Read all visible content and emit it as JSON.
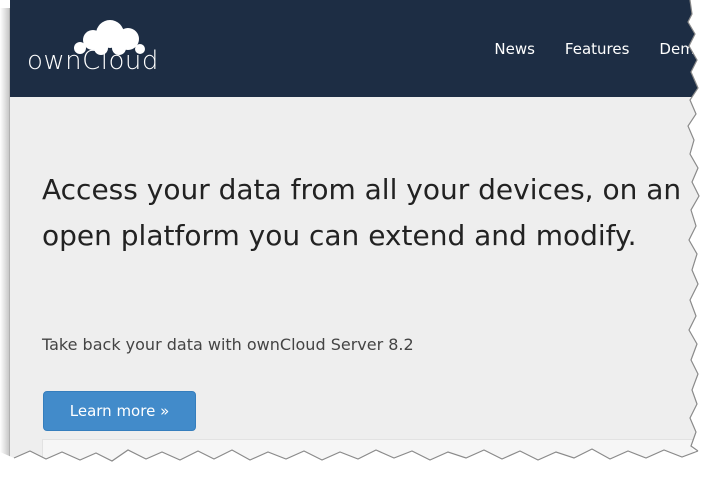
{
  "brand": {
    "logo_text": "ownCloud",
    "icon": "cloud-logo-icon"
  },
  "nav": {
    "items": [
      {
        "label": "News"
      },
      {
        "label": "Features"
      },
      {
        "label": "Demo"
      }
    ]
  },
  "hero": {
    "title": "Access your data from all your devices, on an open platform you can extend and modify.",
    "subtitle": "Take back your data with ownCloud Server 8.2",
    "button_label": "Learn more »"
  },
  "colors": {
    "navbar_bg": "#1d2d44",
    "hero_bg": "#eeeeee",
    "button_bg": "#428bca"
  }
}
